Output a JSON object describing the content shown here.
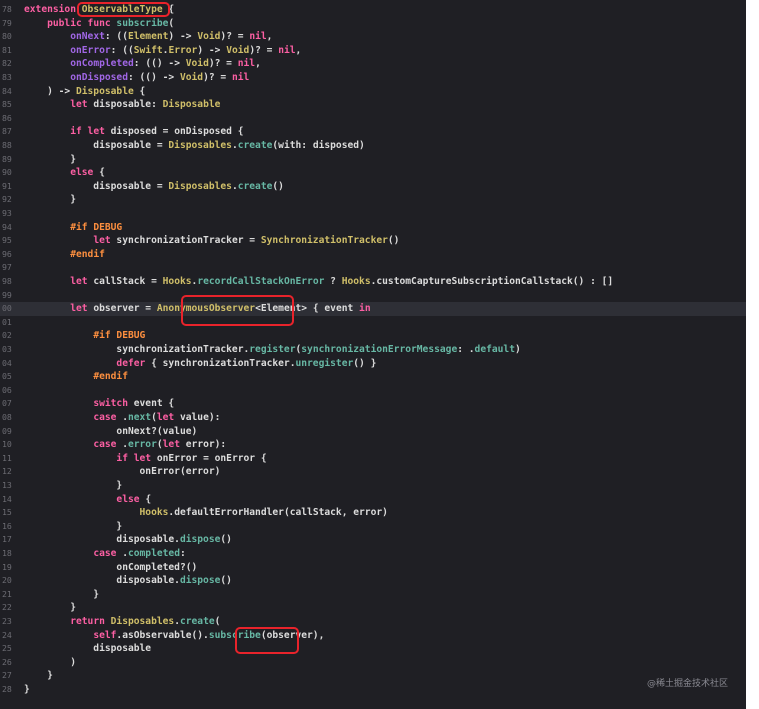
{
  "editor": {
    "colors": {
      "background": "#1f1f24",
      "keyword": "#fc5fa3",
      "type": "#d0bf69",
      "function": "#67b7a4",
      "label": "#a167e6",
      "preprocessor": "#fd8f3f",
      "highlight_box": "#e8232b"
    },
    "watermark": "@稀土掘金技术社区",
    "lines": [
      {
        "n": "78",
        "t": [
          [
            "kw",
            "extension "
          ],
          [
            "ty",
            "ObservableType"
          ],
          [
            "pl",
            " {"
          ]
        ]
      },
      {
        "n": "79",
        "t": [
          [
            "pl",
            "    "
          ],
          [
            "kw",
            "public func "
          ],
          [
            "fn",
            "subscribe"
          ],
          [
            "pl",
            "("
          ]
        ]
      },
      {
        "n": "80",
        "t": [
          [
            "pl",
            "        "
          ],
          [
            "lbl",
            "onNext"
          ],
          [
            "pl",
            ": (("
          ],
          [
            "ty",
            "Element"
          ],
          [
            "pl",
            ") -> "
          ],
          [
            "ty",
            "Void"
          ],
          [
            "pl",
            ")? = "
          ],
          [
            "kw",
            "nil"
          ],
          [
            "pl",
            ","
          ]
        ]
      },
      {
        "n": "81",
        "t": [
          [
            "pl",
            "        "
          ],
          [
            "lbl",
            "onError"
          ],
          [
            "pl",
            ": (("
          ],
          [
            "ty",
            "Swift"
          ],
          [
            "pl",
            "."
          ],
          [
            "ty",
            "Error"
          ],
          [
            "pl",
            ") -> "
          ],
          [
            "ty",
            "Void"
          ],
          [
            "pl",
            ")? = "
          ],
          [
            "kw",
            "nil"
          ],
          [
            "pl",
            ","
          ]
        ]
      },
      {
        "n": "82",
        "t": [
          [
            "pl",
            "        "
          ],
          [
            "lbl",
            "onCompleted"
          ],
          [
            "pl",
            ": (() -> "
          ],
          [
            "ty",
            "Void"
          ],
          [
            "pl",
            ")? = "
          ],
          [
            "kw",
            "nil"
          ],
          [
            "pl",
            ","
          ]
        ]
      },
      {
        "n": "83",
        "t": [
          [
            "pl",
            "        "
          ],
          [
            "lbl",
            "onDisposed"
          ],
          [
            "pl",
            ": (() -> "
          ],
          [
            "ty",
            "Void"
          ],
          [
            "pl",
            ")? = "
          ],
          [
            "kw",
            "nil"
          ]
        ]
      },
      {
        "n": "84",
        "t": [
          [
            "pl",
            "    ) -> "
          ],
          [
            "ty",
            "Disposable"
          ],
          [
            "pl",
            " {"
          ]
        ]
      },
      {
        "n": "85",
        "t": [
          [
            "pl",
            "        "
          ],
          [
            "kw",
            "let "
          ],
          [
            "pl",
            "disposable: "
          ],
          [
            "ty",
            "Disposable"
          ]
        ]
      },
      {
        "n": "86",
        "t": []
      },
      {
        "n": "87",
        "t": [
          [
            "pl",
            "        "
          ],
          [
            "kw",
            "if let "
          ],
          [
            "pl",
            "disposed = onDisposed {"
          ]
        ]
      },
      {
        "n": "88",
        "t": [
          [
            "pl",
            "            disposable = "
          ],
          [
            "ty",
            "Disposables"
          ],
          [
            "pl",
            "."
          ],
          [
            "fn",
            "create"
          ],
          [
            "pl",
            "(with: disposed)"
          ]
        ]
      },
      {
        "n": "89",
        "t": [
          [
            "pl",
            "        }"
          ]
        ]
      },
      {
        "n": "90",
        "t": [
          [
            "pl",
            "        "
          ],
          [
            "kw",
            "else "
          ],
          [
            "pl",
            "{"
          ]
        ]
      },
      {
        "n": "91",
        "t": [
          [
            "pl",
            "            disposable = "
          ],
          [
            "ty",
            "Disposables"
          ],
          [
            "pl",
            "."
          ],
          [
            "fn",
            "create"
          ],
          [
            "pl",
            "()"
          ]
        ]
      },
      {
        "n": "92",
        "t": [
          [
            "pl",
            "        }"
          ]
        ]
      },
      {
        "n": "93",
        "t": []
      },
      {
        "n": "94",
        "t": [
          [
            "pl",
            "        "
          ],
          [
            "pp",
            "#if DEBUG"
          ]
        ]
      },
      {
        "n": "95",
        "t": [
          [
            "pl",
            "            "
          ],
          [
            "kw",
            "let "
          ],
          [
            "pl",
            "synchronizationTracker = "
          ],
          [
            "ty",
            "SynchronizationTracker"
          ],
          [
            "pl",
            "()"
          ]
        ]
      },
      {
        "n": "96",
        "t": [
          [
            "pl",
            "        "
          ],
          [
            "pp",
            "#endif"
          ]
        ]
      },
      {
        "n": "97",
        "t": []
      },
      {
        "n": "98",
        "t": [
          [
            "pl",
            "        "
          ],
          [
            "kw",
            "let "
          ],
          [
            "pl",
            "callStack = "
          ],
          [
            "ty",
            "Hooks"
          ],
          [
            "pl",
            "."
          ],
          [
            "fn",
            "recordCallStackOnError"
          ],
          [
            "pl",
            " ? "
          ],
          [
            "ty",
            "Hooks"
          ],
          [
            "pl",
            ".customCaptureSubscriptionCallstack() : []"
          ]
        ]
      },
      {
        "n": "99",
        "t": []
      },
      {
        "n": "00",
        "t": [
          [
            "pl",
            "        "
          ],
          [
            "kw",
            "let "
          ],
          [
            "pl",
            "observer = "
          ],
          [
            "ty",
            "AnonymousObserver"
          ],
          [
            "pl",
            "<Element> { event "
          ],
          [
            "kw",
            "in"
          ]
        ],
        "hl": true
      },
      {
        "n": "01",
        "t": []
      },
      {
        "n": "02",
        "t": [
          [
            "pl",
            "            "
          ],
          [
            "pp",
            "#if DEBUG"
          ]
        ]
      },
      {
        "n": "03",
        "t": [
          [
            "pl",
            "                synchronizationTracker."
          ],
          [
            "fn",
            "register"
          ],
          [
            "pl",
            "("
          ],
          [
            "fn",
            "synchronizationErrorMessage"
          ],
          [
            "pl",
            ": ."
          ],
          [
            "fn",
            "default"
          ],
          [
            "pl",
            ")"
          ]
        ]
      },
      {
        "n": "04",
        "t": [
          [
            "pl",
            "                "
          ],
          [
            "kw",
            "defer "
          ],
          [
            "pl",
            "{ synchronizationTracker."
          ],
          [
            "fn",
            "unregister"
          ],
          [
            "pl",
            "() }"
          ]
        ]
      },
      {
        "n": "05",
        "t": [
          [
            "pl",
            "            "
          ],
          [
            "pp",
            "#endif"
          ]
        ]
      },
      {
        "n": "06",
        "t": []
      },
      {
        "n": "07",
        "t": [
          [
            "pl",
            "            "
          ],
          [
            "kw",
            "switch "
          ],
          [
            "pl",
            "event {"
          ]
        ]
      },
      {
        "n": "08",
        "t": [
          [
            "pl",
            "            "
          ],
          [
            "kw",
            "case "
          ],
          [
            "pl",
            "."
          ],
          [
            "fn",
            "next"
          ],
          [
            "pl",
            "("
          ],
          [
            "kw",
            "let "
          ],
          [
            "pl",
            "value):"
          ]
        ]
      },
      {
        "n": "09",
        "t": [
          [
            "pl",
            "                onNext?(value)"
          ]
        ]
      },
      {
        "n": "10",
        "t": [
          [
            "pl",
            "            "
          ],
          [
            "kw",
            "case "
          ],
          [
            "pl",
            "."
          ],
          [
            "fn",
            "error"
          ],
          [
            "pl",
            "("
          ],
          [
            "kw",
            "let "
          ],
          [
            "pl",
            "error):"
          ]
        ]
      },
      {
        "n": "11",
        "t": [
          [
            "pl",
            "                "
          ],
          [
            "kw",
            "if let "
          ],
          [
            "pl",
            "onError = onError {"
          ]
        ]
      },
      {
        "n": "12",
        "t": [
          [
            "pl",
            "                    onError(error)"
          ]
        ]
      },
      {
        "n": "13",
        "t": [
          [
            "pl",
            "                }"
          ]
        ]
      },
      {
        "n": "14",
        "t": [
          [
            "pl",
            "                "
          ],
          [
            "kw",
            "else "
          ],
          [
            "pl",
            "{"
          ]
        ]
      },
      {
        "n": "15",
        "t": [
          [
            "pl",
            "                    "
          ],
          [
            "ty",
            "Hooks"
          ],
          [
            "pl",
            ".defaultErrorHandler(callStack, error)"
          ]
        ]
      },
      {
        "n": "16",
        "t": [
          [
            "pl",
            "                }"
          ]
        ]
      },
      {
        "n": "17",
        "t": [
          [
            "pl",
            "                disposable."
          ],
          [
            "fn",
            "dispose"
          ],
          [
            "pl",
            "()"
          ]
        ]
      },
      {
        "n": "18",
        "t": [
          [
            "pl",
            "            "
          ],
          [
            "kw",
            "case "
          ],
          [
            "pl",
            "."
          ],
          [
            "fn",
            "completed"
          ],
          [
            "pl",
            ":"
          ]
        ]
      },
      {
        "n": "19",
        "t": [
          [
            "pl",
            "                onCompleted?()"
          ]
        ]
      },
      {
        "n": "20",
        "t": [
          [
            "pl",
            "                disposable."
          ],
          [
            "fn",
            "dispose"
          ],
          [
            "pl",
            "()"
          ]
        ]
      },
      {
        "n": "21",
        "t": [
          [
            "pl",
            "            }"
          ]
        ]
      },
      {
        "n": "22",
        "t": [
          [
            "pl",
            "        }"
          ]
        ]
      },
      {
        "n": "23",
        "t": [
          [
            "pl",
            "        "
          ],
          [
            "kw",
            "return "
          ],
          [
            "ty",
            "Disposables"
          ],
          [
            "pl",
            "."
          ],
          [
            "fn",
            "create"
          ],
          [
            "pl",
            "("
          ]
        ]
      },
      {
        "n": "24",
        "t": [
          [
            "pl",
            "            "
          ],
          [
            "kw",
            "self"
          ],
          [
            "pl",
            ".asObservable()."
          ],
          [
            "fn",
            "subscribe"
          ],
          [
            "pl",
            "(observer),"
          ]
        ]
      },
      {
        "n": "25",
        "t": [
          [
            "pl",
            "            disposable"
          ]
        ]
      },
      {
        "n": "26",
        "t": [
          [
            "pl",
            "        )"
          ]
        ]
      },
      {
        "n": "27",
        "t": [
          [
            "pl",
            "    }"
          ]
        ]
      },
      {
        "n": "28",
        "t": [
          [
            "pl",
            "}"
          ]
        ]
      }
    ]
  }
}
